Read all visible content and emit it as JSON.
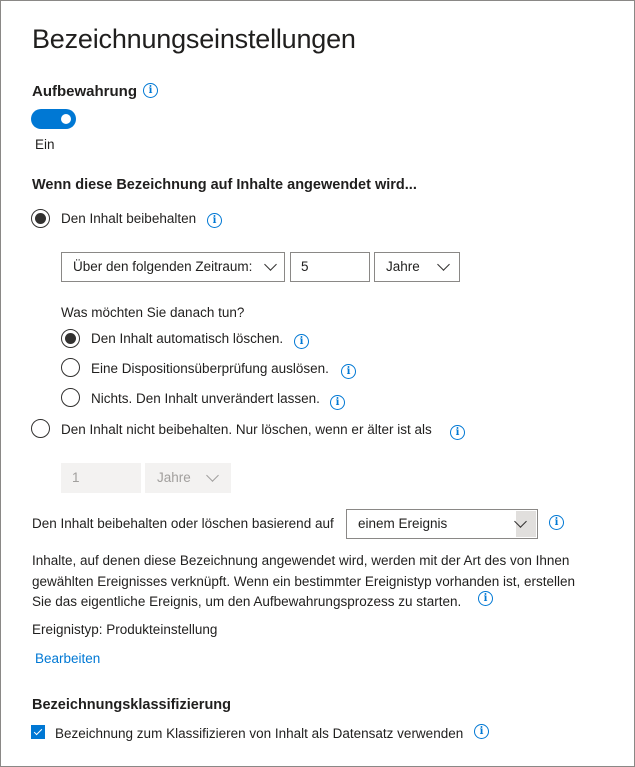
{
  "page": {
    "title": "Bezeichnungseinstellungen"
  },
  "retention": {
    "heading": "Aufbewahrung",
    "toggle_state_label": "Ein",
    "toggle_on": true
  },
  "applied": {
    "heading": "Wenn diese Bezeichnung auf Inhalte angewendet wird...",
    "keep_option_label": "Den Inhalt beibehalten",
    "period_dropdown_value": "Über den folgenden Zeitraum:",
    "period_number_value": "5",
    "period_unit_value": "Jahre",
    "after_question": "Was möchten Sie danach tun?",
    "after_options": [
      {
        "label": "Den Inhalt automatisch löschen.",
        "selected": true
      },
      {
        "label": "Eine Dispositionsüberprüfung auslösen.",
        "selected": false
      },
      {
        "label": "Nichts. Den Inhalt unverändert lassen.",
        "selected": false
      }
    ],
    "no_keep_option_label": "Den Inhalt nicht beibehalten. Nur löschen, wenn er älter ist als",
    "delete_number_value": "1",
    "delete_unit_value": "Jahre"
  },
  "basis": {
    "label": "Den Inhalt beibehalten oder löschen basierend auf",
    "dropdown_value": "einem Ereignis",
    "description": "Inhalte, auf denen diese Bezeichnung angewendet wird, werden mit der Art des von Ihnen gewählten Ereignisses verknüpft. Wenn ein bestimmter Ereignistyp vorhanden ist, erstellen Sie das eigentliche Ereignis, um den Aufbewahrungsprozess zu starten.",
    "event_type": "Ereignistyp: Produkteinstellung",
    "edit_link": "Bearbeiten"
  },
  "classification": {
    "heading": "Bezeichnungsklassifizierung",
    "checkbox_label": "Bezeichnung zum Klassifizieren von Inhalt als Datensatz verwenden",
    "checked": true
  },
  "icons": {
    "info": "i"
  },
  "colors": {
    "accent": "#0078d4",
    "text": "#201f1e",
    "border": "#8a8886",
    "disabled_bg": "#f3f2f1"
  }
}
